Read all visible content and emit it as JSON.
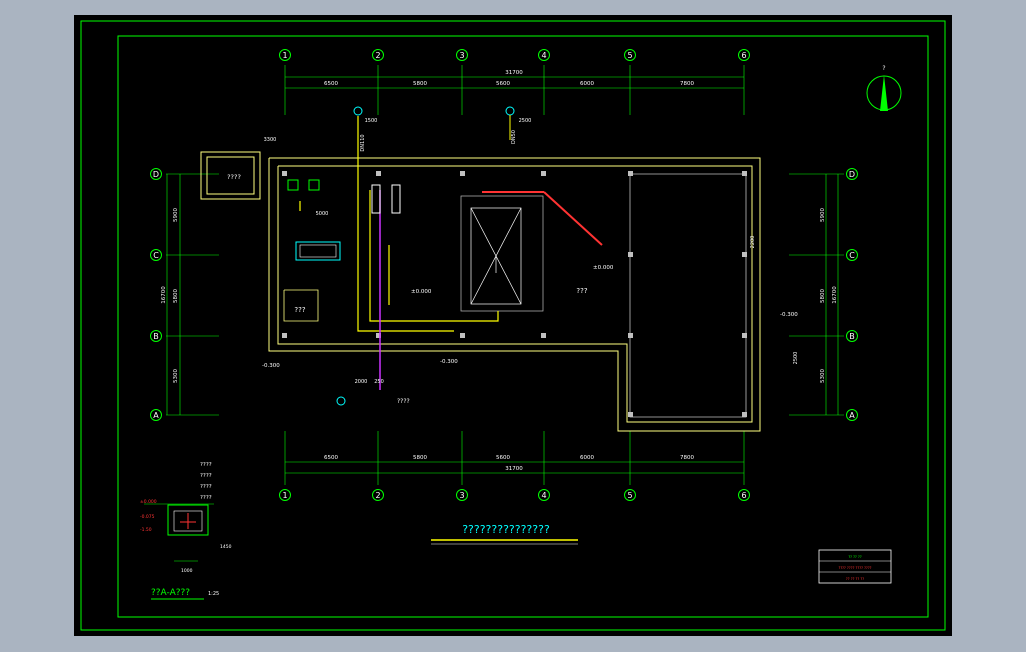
{
  "grid": {
    "columns": [
      "1",
      "2",
      "3",
      "4",
      "5",
      "6"
    ],
    "rows": [
      "D",
      "C",
      "B",
      "A"
    ]
  },
  "dimensions": {
    "top_spans": [
      "6500",
      "5800",
      "5600",
      "6000",
      "7800"
    ],
    "top_total": "31700",
    "bottom_spans": [
      "6500",
      "5800",
      "5600",
      "6000",
      "7800"
    ],
    "bottom_total": "31700",
    "left_spans": [
      "5900",
      "5800",
      "5300"
    ],
    "left_total": "16700",
    "right_spans": [
      "5900",
      "5800",
      "5300"
    ],
    "right_total": "16700",
    "pipe_offset_1": "1500",
    "pipe_offset_2": "2500",
    "pipe_size_1": "DN110",
    "pipe_size_2": "DN50",
    "dim_3300": "3300",
    "dim_5000": "5000",
    "dim_2500": "2500",
    "dim_2200": "2200",
    "dim_1500": "1500",
    "dim_2000": "2000",
    "dim_250": "250"
  },
  "labels": {
    "north": "?",
    "pit_label": "????",
    "small_room": "???",
    "main_room": "???",
    "outside_label": "????",
    "elev_1": "±0.000",
    "elev_2": "±0.000",
    "elev_3": "-0.300",
    "elev_4": "-0.300",
    "elev_5": "-0.300",
    "elev_6": "-0.300",
    "drawing_title": "???????????????",
    "section_title": "??A-A???",
    "section_scale": "1:25"
  },
  "section": {
    "notes": [
      "????",
      "????",
      "????",
      "????"
    ],
    "elevs": [
      "±0.000",
      "-0.075",
      "-1.50"
    ],
    "bottom_dim": "1000",
    "width_dim": "1450"
  },
  "title_block": {
    "line1": "?? ?? ??",
    "line2": "????  ????  ????  ????",
    "line3": "??  ??  ??  ??"
  },
  "colors": {
    "frame": "#00ff00",
    "wall": "#ffff80",
    "pipe_yellow": "#ffff00",
    "pipe_magenta": "#cc33ff",
    "pipe_red": "#ff3333",
    "equipment": "#00ffff",
    "column": "#c0c0c0"
  }
}
